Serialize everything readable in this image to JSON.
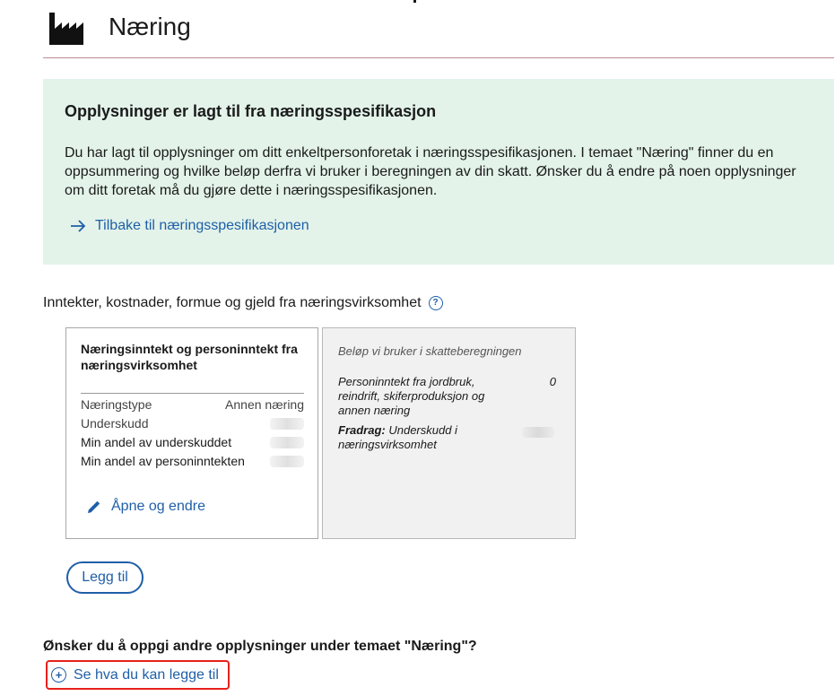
{
  "page": {
    "title": "Næring"
  },
  "info": {
    "title": "Opplysninger er lagt til fra næringsspesifikasjon",
    "body": "Du har lagt til opplysninger om ditt enkeltpersonforetak i næringsspesifikasjonen. I temaet \"Næring\" finner du en oppsummering og hvilke beløp derfra vi bruker i beregningen av din skatt. Ønsker du å endre på noen opplysninger om ditt foretak må du gjøre dette i næringsspesifikasjonen.",
    "link_label": "Tilbake til næringsspesifikasjonen"
  },
  "section": {
    "label": "Inntekter, kostnader, formue og gjeld fra næringsvirksomhet",
    "help_icon": "question-circle-icon"
  },
  "card": {
    "title": "Næringsinntekt og personinntekt fra næringsvirksomhet",
    "rows": [
      {
        "label": "Næringstype",
        "value": "Annen næring"
      },
      {
        "label": "Underskudd",
        "value": null
      },
      {
        "label": "Min andel av underskuddet",
        "value": null
      },
      {
        "label": "Min andel av personinntekten",
        "value": null
      }
    ],
    "edit_label": "Åpne og endre"
  },
  "calc": {
    "title": "Beløp vi bruker i skatteberegningen",
    "row1_label": "Personinntekt fra jordbruk, reindrift, skiferproduksjon og annen næring",
    "row1_value": "0",
    "row2_bold": "Fradrag:",
    "row2_label": " Underskudd i næringsvirksomhet"
  },
  "add_button": "Legg til",
  "question": "Ønsker du å oppgi andre opplysninger under temaet \"Næring\"?",
  "see_link": "Se hva du kan legge til",
  "colors": {
    "accent": "#1f5fa8",
    "info_bg": "#e3f3e9",
    "highlight": "#e8201a"
  }
}
